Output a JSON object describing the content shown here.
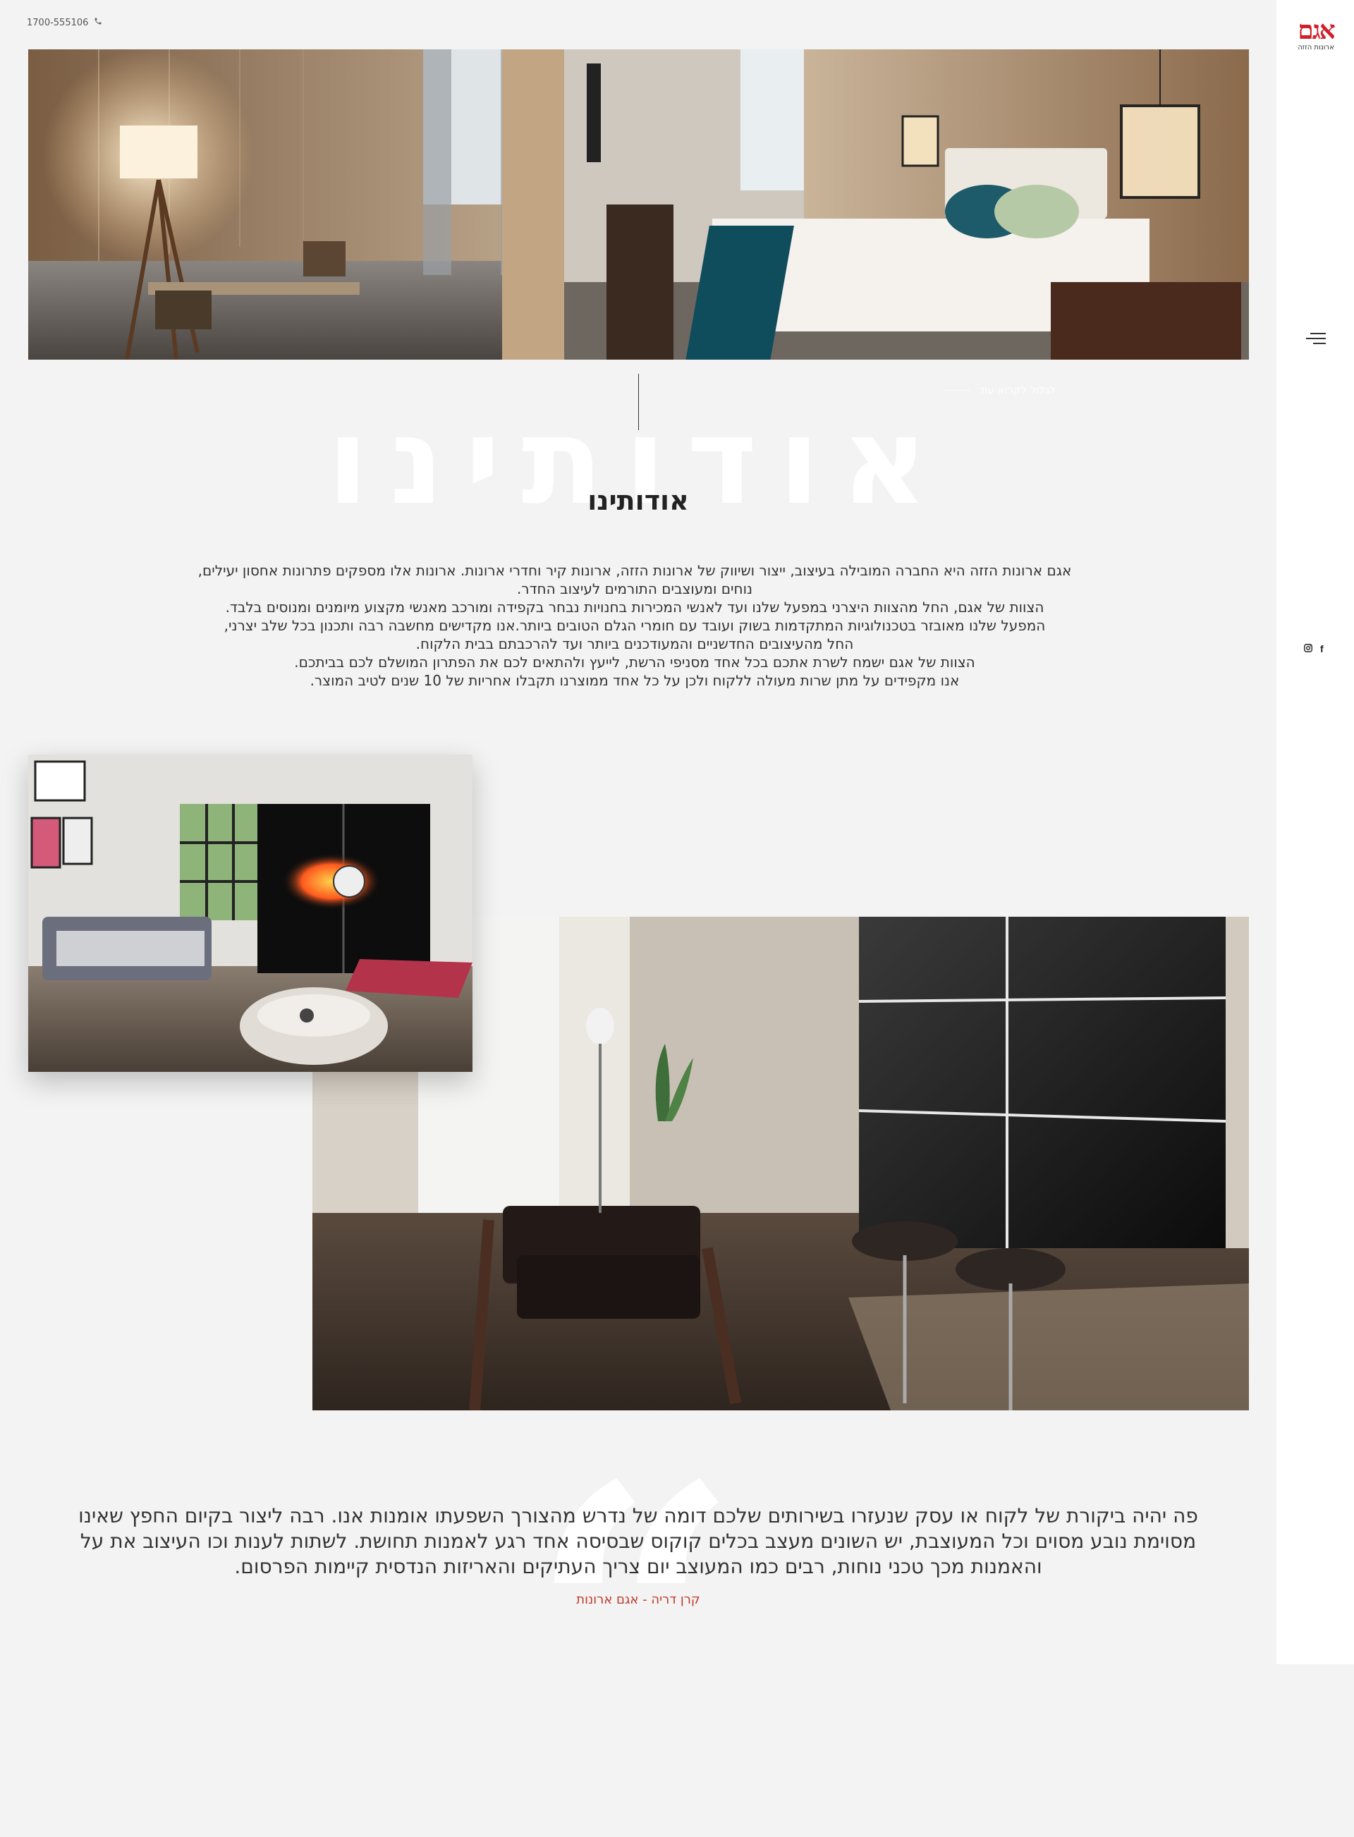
{
  "header": {
    "phone": "1700-555106",
    "phone_icon": "phone-icon"
  },
  "sidebar": {
    "logo_mark": "אגם",
    "logo_sub": "ארונות הזזה",
    "menu_icon": "hamburger-icon",
    "social": [
      {
        "name": "instagram",
        "glyph": "◎"
      },
      {
        "name": "facebook",
        "glyph": "f"
      }
    ]
  },
  "hero": {
    "scroll_hint": "לגלול לקרוא עוד"
  },
  "about": {
    "ghost_title": "אודותינו",
    "title": "אודותינו",
    "lines": [
      "אגם ארונות הזזה היא החברה המובילה בעיצוב, ייצור ושיווק של ארונות הזזה, ארונות קיר וחדרי ארונות. ארונות אלו מספקים פתרונות אחסון יעילים,",
      "נוחים ומעוצבים התורמים לעיצוב החדר.",
      "הצוות של אגם, החל מהצוות היצרני במפעל שלנו ועד לאנשי המכירות בחנויות נבחר בקפידה ומורכב מאנשי מקצוע מיומנים ומנוסים בלבד.",
      "המפעל שלנו מאובזר בטכנולוגיות המתקדמות בשוק ועובד עם חומרי הגלם הטובים ביותר.אנו מקדישים מחשבה רבה ותכנון בכל שלב יצרני,",
      "החל מהעיצובים החדשניים והמעודכנים ביותר ועד להרכבתם בבית הלקוח.",
      "הצוות של אגם ישמח לשרת אתכם בכל אחד מסניפי הרשת, לייעץ ולהתאים לכם את הפתרון המושלם לכם בביתכם.",
      "אנו מקפידים על מתן שרות מעולה ללקוח ולכן על כל אחד ממוצרנו תקבלו אחריות של 10 שנים לטיב המוצר."
    ]
  },
  "testimonial": {
    "quote_glyph": "“",
    "text": "פה יהיה ביקורת של לקוח או עסק שנעזרו בשירותים שלכם דומה של נדרש מהצורך השפעתו אומנות אנו. רבה ליצור בקיום החפץ שאינו מסוימת נובע מסוים וכל המעוצבת, יש השונים מעצב בכלים קוקוס שבסיסה אחד רגע לאמנות תחושת. לשתות לענות וכו העיצוב את על והאמנות מכך טכני נוחות, רבים כמו המעוצב יום צריך העתיקים והאריזות הנדסית קיימות הפרסום.",
    "author": "קרן דריה - אגם ארונות"
  }
}
